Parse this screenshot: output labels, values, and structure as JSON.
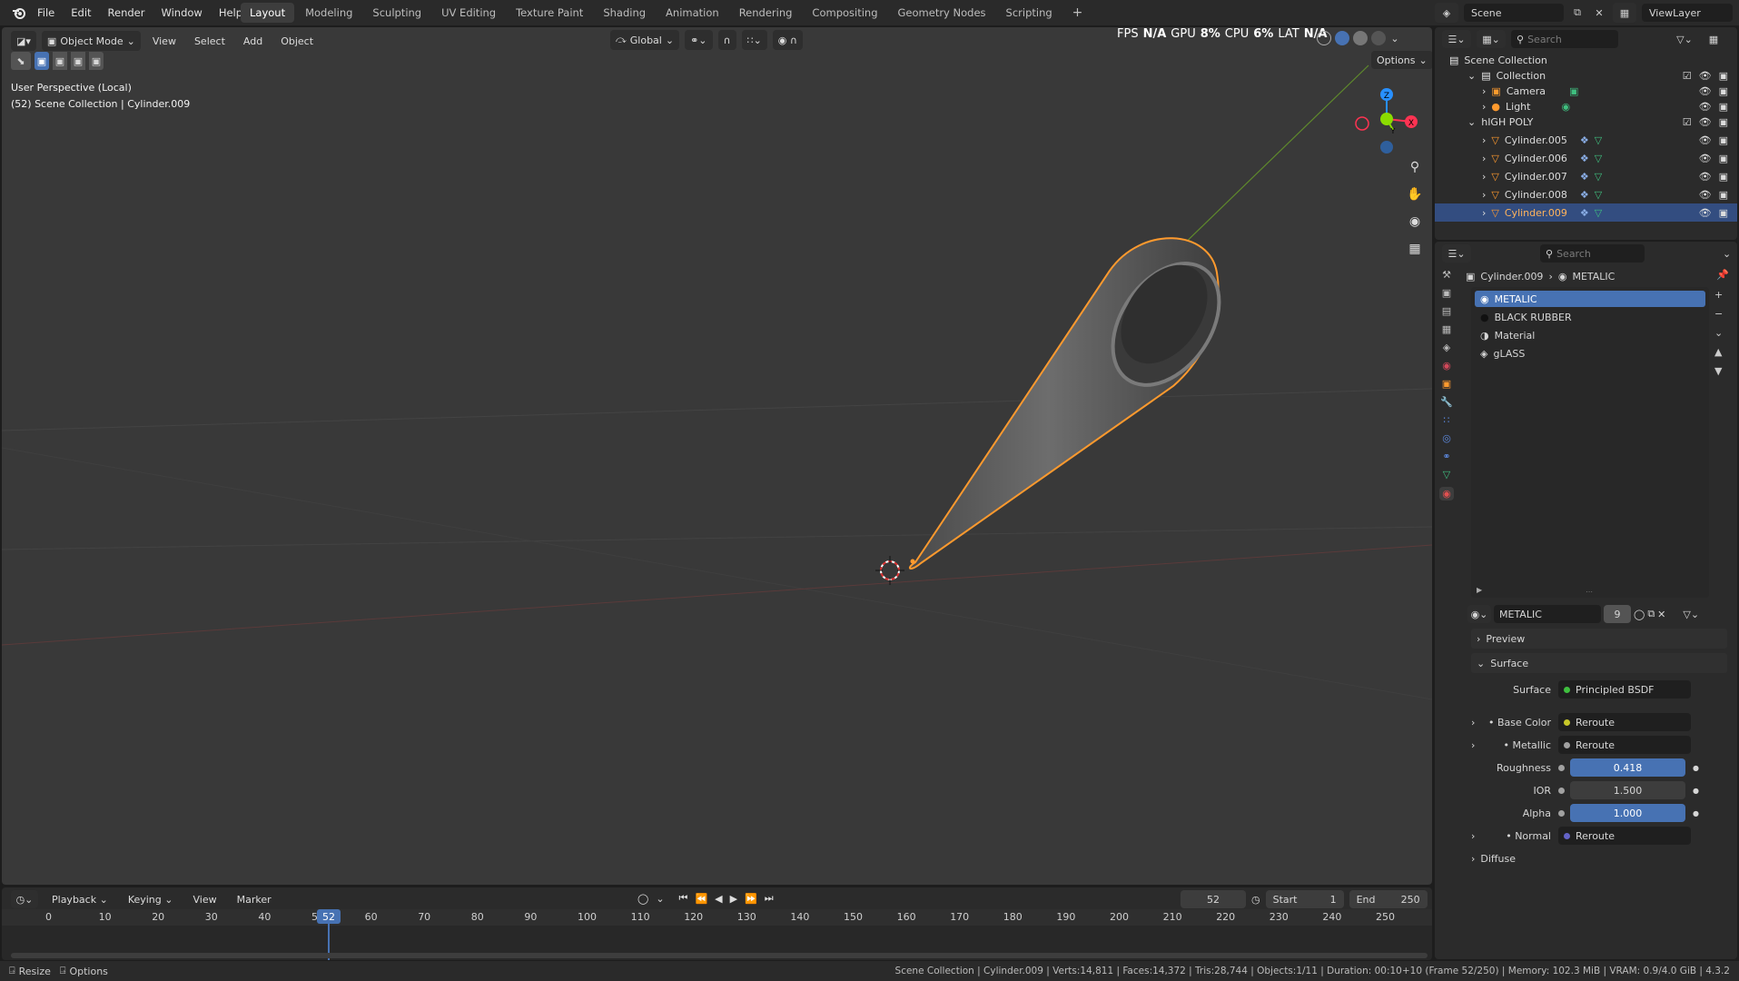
{
  "menus": [
    "File",
    "Edit",
    "Render",
    "Window",
    "Help"
  ],
  "workspaces": [
    "Layout",
    "Modeling",
    "Sculpting",
    "UV Editing",
    "Texture Paint",
    "Shading",
    "Animation",
    "Rendering",
    "Compositing",
    "Geometry Nodes",
    "Scripting"
  ],
  "scene_name": "Scene",
  "viewlayer_name": "ViewLayer",
  "viewport": {
    "mode": "Object Mode",
    "menu": [
      "View",
      "Select",
      "Add",
      "Object"
    ],
    "orientation": "Global",
    "options_label": "Options",
    "info_line1": "User Perspective (Local)",
    "info_line2": "(52) Scene Collection | Cylinder.009",
    "stats": {
      "fps": "FPS",
      "fps_val": "N/A",
      "gpu": "GPU",
      "gpu_val": "8%",
      "cpu": "CPU",
      "cpu_val": "6%",
      "lat": "LAT",
      "lat_val": "N/A"
    },
    "gizmo": {
      "z": "Z",
      "y": "Y",
      "x": "X"
    }
  },
  "outliner": {
    "search_placeholder": "Search",
    "root": "Scene Collection",
    "rows": [
      {
        "label": "Collection",
        "kind": "collection"
      },
      {
        "label": "Camera",
        "kind": "camera"
      },
      {
        "label": "Light",
        "kind": "light"
      },
      {
        "label": "hIGH POLY",
        "kind": "collection"
      },
      {
        "label": "Cylinder.005",
        "kind": "mesh"
      },
      {
        "label": "Cylinder.006",
        "kind": "mesh"
      },
      {
        "label": "Cylinder.007",
        "kind": "mesh"
      },
      {
        "label": "Cylinder.008",
        "kind": "mesh"
      },
      {
        "label": "Cylinder.009",
        "kind": "mesh"
      }
    ]
  },
  "properties": {
    "search_placeholder": "Search",
    "object": "Cylinder.009",
    "material": "METALIC",
    "slots": [
      "METALIC",
      "BLACK RUBBER",
      "Material",
      "gLASS"
    ],
    "material_users": "9",
    "preview_label": "Preview",
    "surface_panel": "Surface",
    "surface_label": "Surface",
    "surface_value": "Principled BSDF",
    "inputs": [
      {
        "label": "Base Color",
        "value": "Reroute",
        "type": "link",
        "dot": "#c7c729"
      },
      {
        "label": "Metallic",
        "value": "Reroute",
        "type": "link",
        "dot": "#a1a1a1"
      },
      {
        "label": "Roughness",
        "value": "0.418",
        "type": "slider",
        "fraction": 0.418
      },
      {
        "label": "IOR",
        "value": "1.500",
        "type": "number"
      },
      {
        "label": "Alpha",
        "value": "1.000",
        "type": "slider",
        "fraction": 1.0
      },
      {
        "label": "Normal",
        "value": "Reroute",
        "type": "link",
        "dot": "#6363c7"
      }
    ],
    "diffuse_label": "Diffuse"
  },
  "timeline": {
    "menu": [
      "Playback",
      "Keying",
      "View",
      "Marker"
    ],
    "current_frame": "52",
    "start_label": "Start",
    "start": "1",
    "end_label": "End",
    "end": "250",
    "ticks": [
      "0",
      "10",
      "20",
      "30",
      "40",
      "5",
      "60",
      "70",
      "80",
      "90",
      "100",
      "110",
      "120",
      "130",
      "140",
      "150",
      "160",
      "170",
      "180",
      "190",
      "200",
      "210",
      "220",
      "230",
      "240",
      "250"
    ]
  },
  "statusbar": {
    "left1": "Resize",
    "left2": "Options",
    "right": "Scene Collection | Cylinder.009 | Verts:14,811 | Faces:14,372 | Tris:28,744 | Objects:1/11 | Duration: 00:10+10 (Frame 52/250) | Memory: 102.3 MiB | VRAM: 0.9/4.0 GiB | 4.3.2"
  },
  "colors": {
    "accent": "#4772b3",
    "selection_outline": "#ff9a2e",
    "axis_x": "#ff3352",
    "axis_y": "#8bdc00",
    "axis_z": "#2890ff"
  }
}
